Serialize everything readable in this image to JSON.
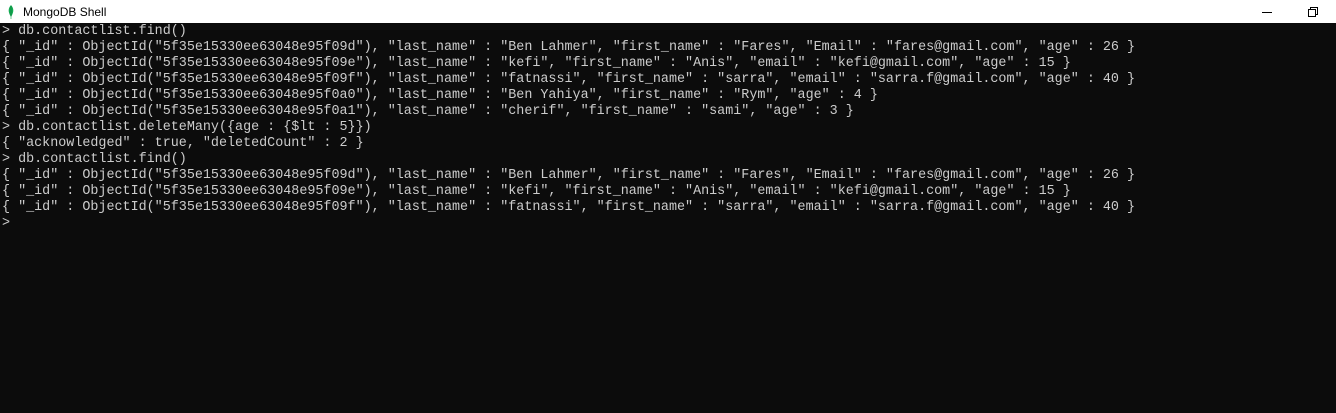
{
  "window": {
    "title": "MongoDB Shell",
    "icon": "mongodb-leaf-icon",
    "controls": [
      "minimize-icon",
      "restore-icon"
    ]
  },
  "colors": {
    "console_background": "#0c0c0c",
    "console_text": "#cccccc",
    "titlebar_background": "#ffffff",
    "leaf_green": "#13aa52"
  },
  "console": {
    "lines": [
      "> db.contactlist.find()",
      "{ \"_id\" : ObjectId(\"5f35e15330ee63048e95f09d\"), \"last_name\" : \"Ben Lahmer\", \"first_name\" : \"Fares\", \"Email\" : \"fares@gmail.com\", \"age\" : 26 }",
      "{ \"_id\" : ObjectId(\"5f35e15330ee63048e95f09e\"), \"last_name\" : \"kefi\", \"first_name\" : \"Anis\", \"email\" : \"kefi@gmail.com\", \"age\" : 15 }",
      "{ \"_id\" : ObjectId(\"5f35e15330ee63048e95f09f\"), \"last_name\" : \"fatnassi\", \"first_name\" : \"sarra\", \"email\" : \"sarra.f@gmail.com\", \"age\" : 40 }",
      "{ \"_id\" : ObjectId(\"5f35e15330ee63048e95f0a0\"), \"last_name\" : \"Ben Yahiya\", \"first_name\" : \"Rym\", \"age\" : 4 }",
      "{ \"_id\" : ObjectId(\"5f35e15330ee63048e95f0a1\"), \"last_name\" : \"cherif\", \"first_name\" : \"sami\", \"age\" : 3 }",
      "> db.contactlist.deleteMany({age : {$lt : 5}})",
      "{ \"acknowledged\" : true, \"deletedCount\" : 2 }",
      "> db.contactlist.find()",
      "{ \"_id\" : ObjectId(\"5f35e15330ee63048e95f09d\"), \"last_name\" : \"Ben Lahmer\", \"first_name\" : \"Fares\", \"Email\" : \"fares@gmail.com\", \"age\" : 26 }",
      "{ \"_id\" : ObjectId(\"5f35e15330ee63048e95f09e\"), \"last_name\" : \"kefi\", \"first_name\" : \"Anis\", \"email\" : \"kefi@gmail.com\", \"age\" : 15 }",
      "{ \"_id\" : ObjectId(\"5f35e15330ee63048e95f09f\"), \"last_name\" : \"fatnassi\", \"first_name\" : \"sarra\", \"email\" : \"sarra.f@gmail.com\", \"age\" : 40 }"
    ],
    "prompt": ">"
  }
}
